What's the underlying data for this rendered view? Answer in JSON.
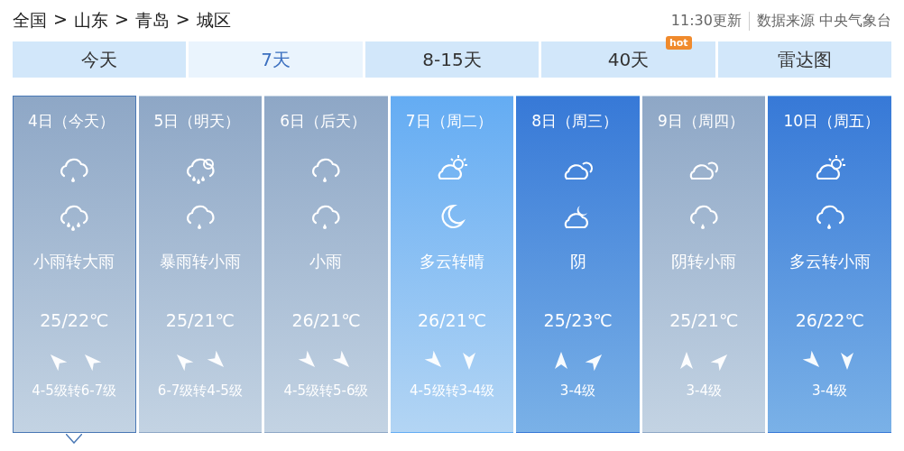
{
  "breadcrumb": {
    "separator": ">",
    "items": [
      "全国",
      "山东",
      "青岛",
      "城区"
    ]
  },
  "update_time": "11:30更新",
  "source": "数据来源 中央气象台",
  "tabs": [
    {
      "label": "今天",
      "selected": false
    },
    {
      "label": "7天",
      "selected": true
    },
    {
      "label": "8-15天",
      "selected": false
    },
    {
      "label": "40天",
      "selected": false,
      "badge": "hot"
    },
    {
      "label": "雷达图",
      "selected": false
    }
  ],
  "days": [
    {
      "date": "4日（今天）",
      "kind": "grey",
      "selected": true,
      "icons": [
        {
          "kind": "rain"
        },
        {
          "kind": "downpour"
        }
      ],
      "weather": "小雨转大雨",
      "temp": "25/22℃",
      "wind": [
        {
          "kind": "northwest"
        },
        {
          "kind": "northwest"
        }
      ],
      "wind_level": "4-5级转6-7级"
    },
    {
      "date": "5日（明天）",
      "kind": "grey",
      "selected": false,
      "icons": [
        {
          "kind": "storm"
        },
        {
          "kind": "rain"
        }
      ],
      "weather": "暴雨转小雨",
      "temp": "25/21℃",
      "wind": [
        {
          "kind": "northwest"
        },
        {
          "kind": "southeast"
        }
      ],
      "wind_level": "6-7级转4-5级"
    },
    {
      "date": "6日（后天）",
      "kind": "grey",
      "selected": false,
      "icons": [
        {
          "kind": "rain"
        },
        {
          "kind": "rain"
        }
      ],
      "weather": "小雨",
      "temp": "26/21℃",
      "wind": [
        {
          "kind": "southeast"
        },
        {
          "kind": "southeast"
        }
      ],
      "wind_level": "4-5级转5-6级"
    },
    {
      "date": "7日（周二）",
      "kind": "pale",
      "selected": false,
      "icons": [
        {
          "kind": "suncloud"
        },
        {
          "kind": "moon"
        }
      ],
      "weather": "多云转晴",
      "temp": "26/21℃",
      "wind": [
        {
          "kind": "southeast"
        },
        {
          "kind": "south"
        }
      ],
      "wind_level": "4-5级转3-4级"
    },
    {
      "date": "8日（周三）",
      "kind": "deep",
      "selected": false,
      "icons": [
        {
          "kind": "overcast"
        },
        {
          "kind": "mooncloud"
        }
      ],
      "weather": "阴",
      "temp": "25/23℃",
      "wind": [
        {
          "kind": "north"
        },
        {
          "kind": "northeast"
        }
      ],
      "wind_level": "3-4级"
    },
    {
      "date": "9日（周四）",
      "kind": "grey",
      "selected": false,
      "icons": [
        {
          "kind": "overcast"
        },
        {
          "kind": "rain"
        }
      ],
      "weather": "阴转小雨",
      "temp": "25/21℃",
      "wind": [
        {
          "kind": "north"
        },
        {
          "kind": "northeast"
        }
      ],
      "wind_level": "3-4级"
    },
    {
      "date": "10日（周五）",
      "kind": "deep",
      "selected": false,
      "icons": [
        {
          "kind": "suncloud"
        },
        {
          "kind": "rain"
        }
      ],
      "weather": "多云转小雨",
      "temp": "26/22℃",
      "wind": [
        {
          "kind": "southeast"
        },
        {
          "kind": "south"
        }
      ],
      "wind_level": "3-4级"
    }
  ]
}
